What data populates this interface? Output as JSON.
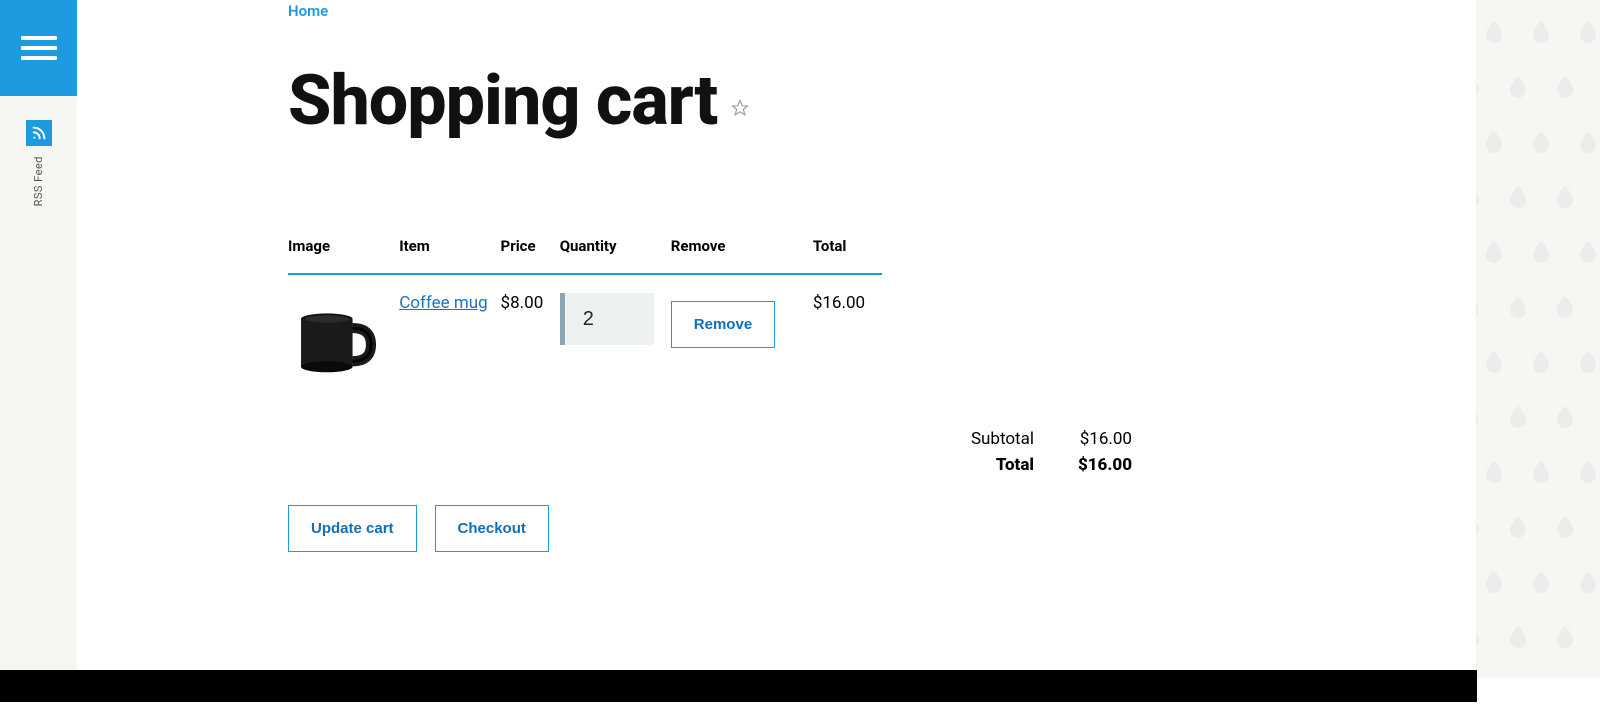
{
  "breadcrumb": {
    "home": "Home"
  },
  "page": {
    "title": "Shopping cart"
  },
  "sidebar": {
    "rss_label": "RSS Feed"
  },
  "cart": {
    "headers": {
      "image": "Image",
      "item": "Item",
      "price": "Price",
      "quantity": "Quantity",
      "remove": "Remove",
      "total": "Total"
    },
    "items": [
      {
        "name": "Coffee mug",
        "price": "$8.00",
        "quantity": "2",
        "total": "$16.00"
      }
    ],
    "remove_label": "Remove"
  },
  "totals": {
    "subtotal_label": "Subtotal",
    "subtotal_value": "$16.00",
    "total_label": "Total",
    "total_value": "$16.00"
  },
  "actions": {
    "update": "Update cart",
    "checkout": "Checkout"
  }
}
